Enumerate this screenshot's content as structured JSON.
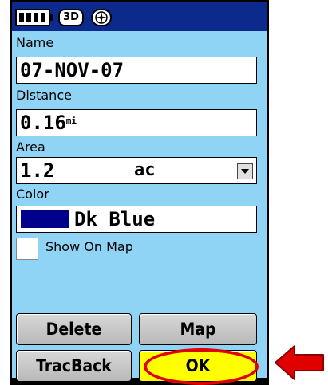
{
  "status_bar": {
    "battery_icon": "battery-icon",
    "gps_badge": "3D",
    "compass_icon": "compass-icon"
  },
  "fields": {
    "name": {
      "label": "Name",
      "value": "07-NOV-07"
    },
    "distance": {
      "label": "Distance",
      "value": "0.16",
      "unit": "mi"
    },
    "area": {
      "label": "Area",
      "value": "1.2",
      "unit": "ac"
    },
    "color": {
      "label": "Color",
      "value": "Dk Blue",
      "swatch": "#00008b"
    }
  },
  "show_on_map": {
    "label": "Show On Map",
    "checked": false
  },
  "buttons": {
    "delete": "Delete",
    "map": "Map",
    "tracback": "TracBack",
    "ok": "OK"
  },
  "colors": {
    "screen_bg": "#8fd3f5",
    "status_bar_bg": "#0b2a8c",
    "highlight": "#e00000",
    "ok_button": "#ffff00"
  }
}
